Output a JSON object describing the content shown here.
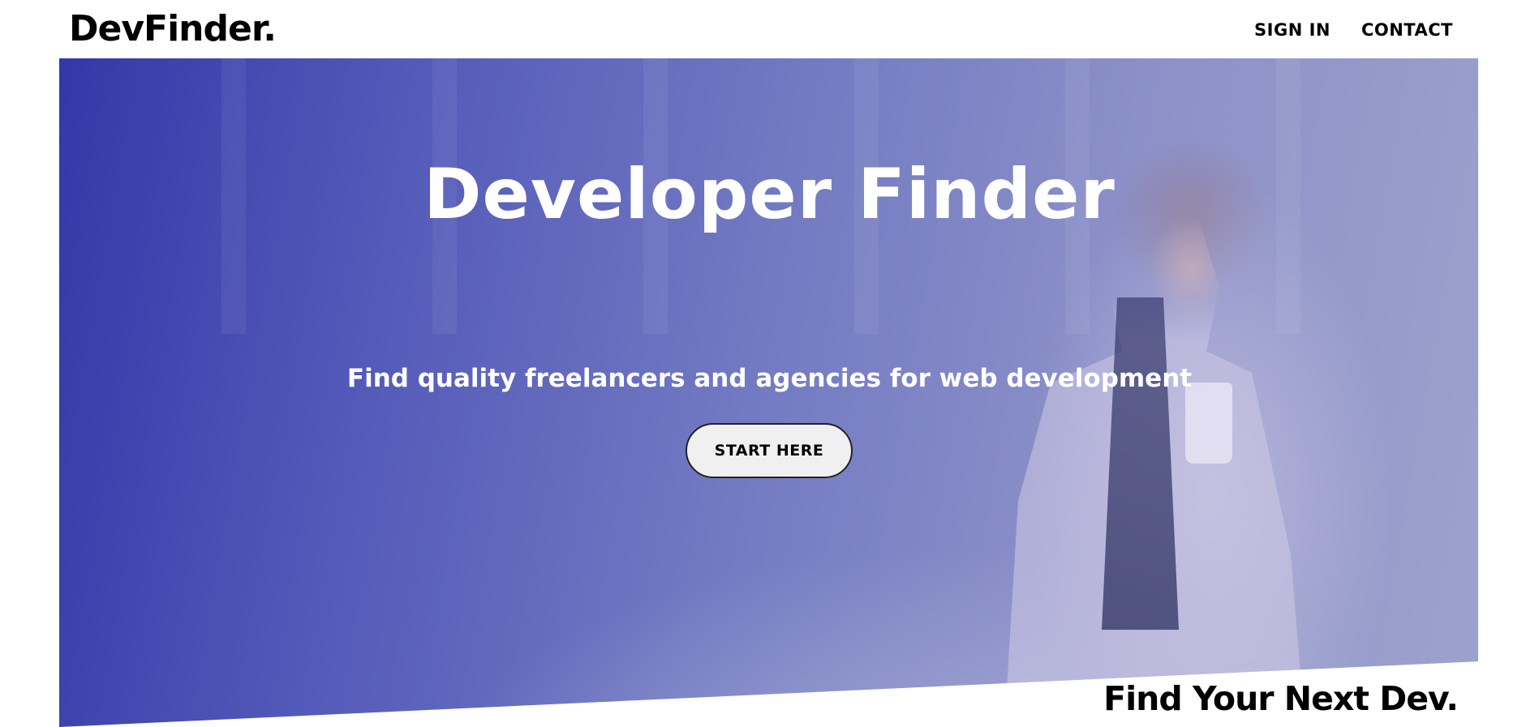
{
  "header": {
    "logo": "DevFinder.",
    "nav": [
      {
        "label": "SIGN IN"
      },
      {
        "label": "CONTACT"
      }
    ]
  },
  "hero": {
    "title": "Developer Finder",
    "subtitle": "Find quality freelancers and agencies for web development",
    "cta_label": "START HERE"
  },
  "section": {
    "title": "Find Your Next Dev."
  },
  "colors": {
    "hero_overlay_start": "#3238a8",
    "hero_overlay_end": "#9da2cc",
    "text_dark": "#000000",
    "text_light": "#ffffff",
    "button_bg": "#f0f0f0"
  }
}
